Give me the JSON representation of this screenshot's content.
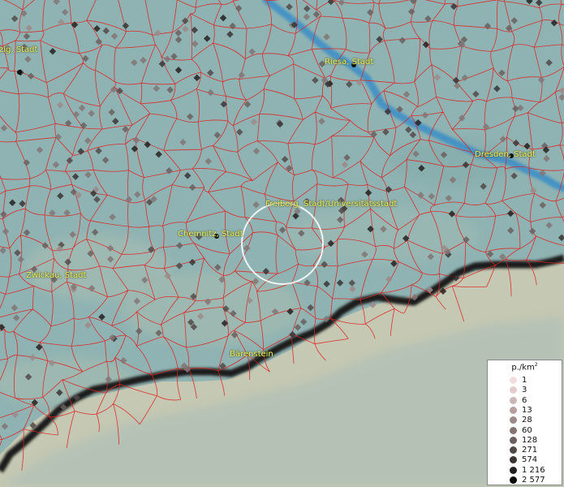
{
  "map": {
    "cities": [
      {
        "key": "zwickau-north",
        "name": "zig, Stadt"
      },
      {
        "key": "riesa",
        "name": "Riesa, Stadt"
      },
      {
        "key": "dresden",
        "name": "Dresden, Stadt"
      },
      {
        "key": "freiberg",
        "name": "Freiberg, Stadt/Universitätsstadt"
      },
      {
        "key": "chemnitz",
        "name": "Chemnitz, Stadt"
      },
      {
        "key": "zwickau",
        "name": "Zwickau, Stadt"
      },
      {
        "key": "baerenstein",
        "name": "Bärenstein"
      }
    ],
    "colors": {
      "lowland": "#8fb3b2",
      "river": "#3a8ec8",
      "borders": "#e02020",
      "national_border": "#1a1a1a",
      "highland": "#c9c7b4",
      "label": "#f1f16a"
    }
  },
  "legend": {
    "unit": "p./km",
    "unit_sup": "2",
    "classes": [
      {
        "label": "1",
        "color": "#f2dede"
      },
      {
        "label": "3",
        "color": "#e3cccc"
      },
      {
        "label": "6",
        "color": "#cdb6b6"
      },
      {
        "label": "13",
        "color": "#b6a0a0"
      },
      {
        "label": "28",
        "color": "#9d8a8a"
      },
      {
        "label": "60",
        "color": "#847474"
      },
      {
        "label": "128",
        "color": "#6b5f5f"
      },
      {
        "label": "271",
        "color": "#524949"
      },
      {
        "label": "574",
        "color": "#3a3434"
      },
      {
        "label": "1 216",
        "color": "#242020"
      },
      {
        "label": "2 577",
        "color": "#0c0a0a"
      }
    ]
  }
}
